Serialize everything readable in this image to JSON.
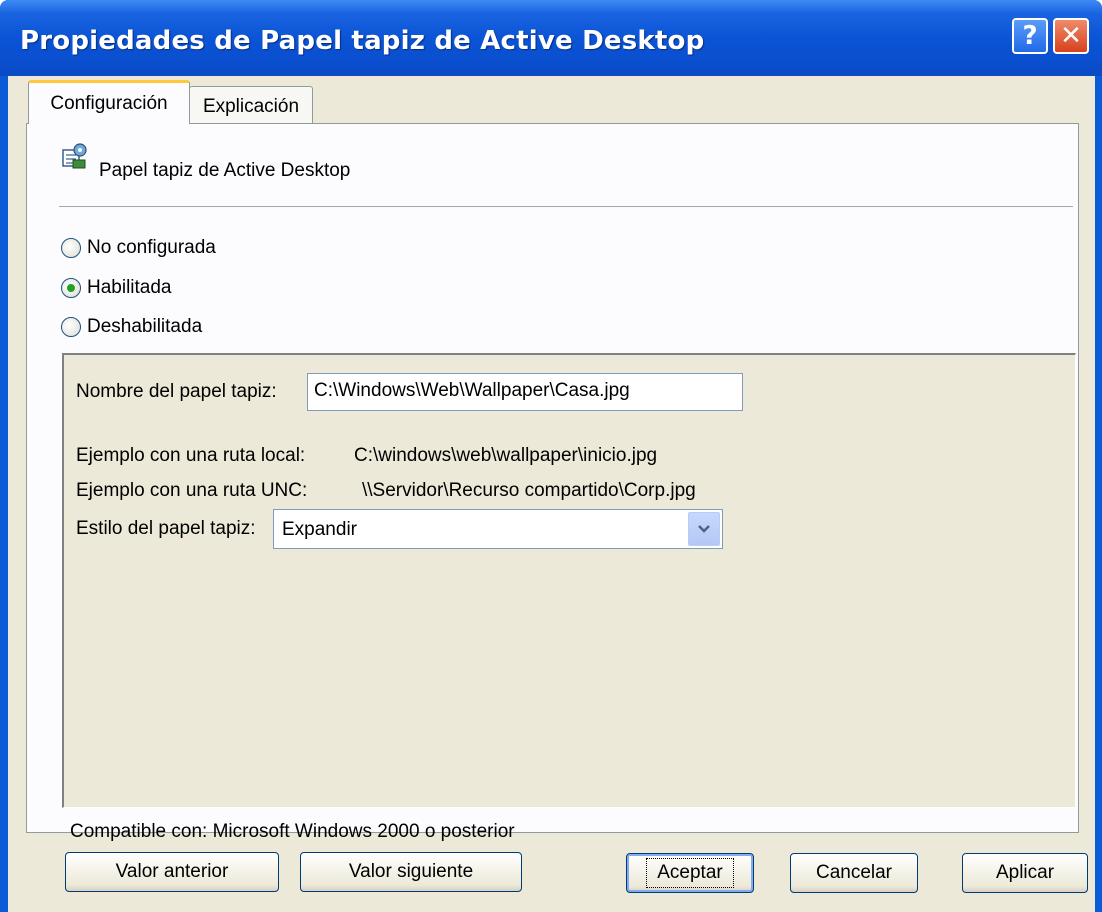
{
  "window": {
    "title": "Propiedades de Papel tapiz de Active Desktop",
    "help_label": "?",
    "close_label": "✕"
  },
  "tabs": [
    {
      "label": "Configuración",
      "active": true
    },
    {
      "label": "Explicación",
      "active": false
    }
  ],
  "policy": {
    "title": "Papel tapiz de Active Desktop",
    "icon": "policy-settings-icon"
  },
  "radios": [
    {
      "label": "No configurada",
      "checked": false
    },
    {
      "label": "Habilitada",
      "checked": true
    },
    {
      "label": "Deshabilitada",
      "checked": false
    }
  ],
  "options": {
    "wallpaper_name_label": "Nombre del papel tapiz:",
    "wallpaper_name_value": "C:\\Windows\\Web\\Wallpaper\\Casa.jpg",
    "example_local_label": "Ejemplo con una ruta local:",
    "example_local_value": "C:\\windows\\web\\wallpaper\\inicio.jpg",
    "example_unc_label": "Ejemplo con una ruta UNC:",
    "example_unc_value": "\\\\Servidor\\Recurso compartido\\Corp.jpg",
    "style_label": "Estilo del papel tapiz:",
    "style_value": "Expandir"
  },
  "compat_text": "Compatible con: Microsoft Windows 2000 o posterior",
  "nav_buttons": {
    "previous": "Valor anterior",
    "next": "Valor siguiente"
  },
  "dialog_buttons": {
    "ok": "Aceptar",
    "cancel": "Cancelar",
    "apply": "Aplicar"
  },
  "colors": {
    "titlebar": "#0a54d6",
    "dialog_bg": "#ece9d8",
    "tab_highlight": "#ffc83c"
  }
}
